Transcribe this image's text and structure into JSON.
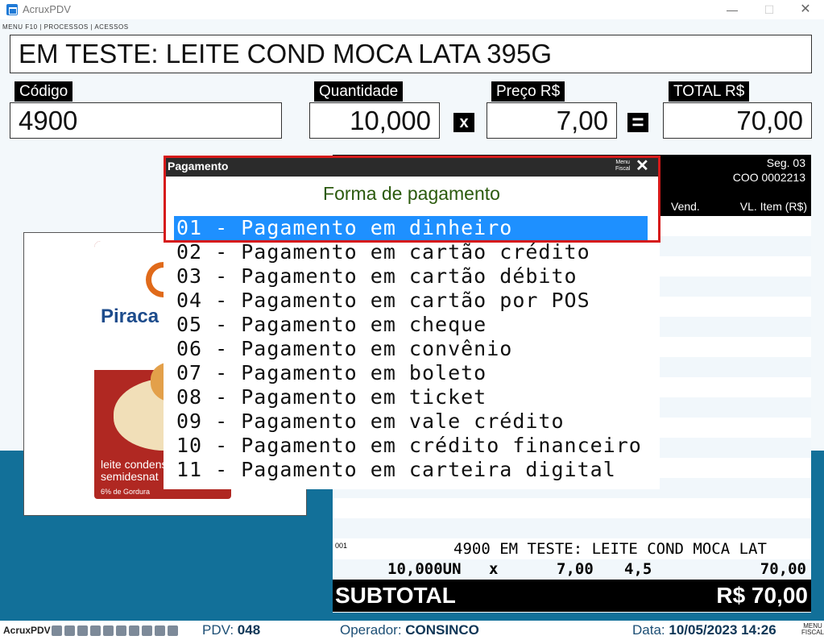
{
  "window": {
    "title": "AcruxPDV",
    "minimize": "—",
    "maximize": "☐",
    "close": "✕"
  },
  "menu_hint": "MENU F10 | PROCESSOS | ACESSOS",
  "product": {
    "title": "EM TESTE: LEITE COND MOCA LATA 395G"
  },
  "fields": {
    "codigo": {
      "label": "Código",
      "value": "4900"
    },
    "quantidade": {
      "label": "Quantidade",
      "value": "10,000"
    },
    "times": "x",
    "preco": {
      "label": "Preço R$",
      "value": "7,00"
    },
    "equals": "=",
    "total": {
      "label": "TOTAL R$",
      "value": "70,00"
    }
  },
  "product_image": {
    "brand": "Piraca",
    "text": "leite condensado semidesnat",
    "subtext": "6% de Gordura"
  },
  "receipt": {
    "seg": "Seg. 03",
    "coo": "COO 0002213",
    "col_vend": "Vend.",
    "col_vl": "VL. Item (R$)",
    "item": {
      "seq": "001",
      "desc": "4900 EM TESTE: LEITE COND MOCA LAT",
      "qty": "10,000UN",
      "x": "x",
      "price": "7,00",
      "aliq": "4,5",
      "total": "70,00"
    },
    "subtotal_label": "SUBTOTAL",
    "subtotal_value": "R$ 70,00"
  },
  "dialog": {
    "title": "Pagamento",
    "menu_top": "Menu",
    "menu_bottom": "Fiscal",
    "close": "✕",
    "subtitle": "Forma de pagamento",
    "options": [
      "01 - Pagamento em dinheiro",
      "02 - Pagamento em cartão crédito",
      "03 - Pagamento em cartão débito",
      "04 - Pagamento em cartão por POS",
      "05 - Pagamento em cheque",
      "06 - Pagamento em convênio",
      "07 - Pagamento em boleto",
      "08 - Pagamento em ticket",
      "09 - Pagamento em vale crédito",
      "10 - Pagamento em crédito financeiro",
      "11 - Pagamento em carteira digital"
    ]
  },
  "status": {
    "app": "AcruxPDV",
    "pdv_label": "PDV:",
    "pdv_value": "048",
    "op_label": "Operador:",
    "op_value": "CONSINCO",
    "data_label": "Data:",
    "data_value": "10/05/2023 14:26",
    "menu_top": "MENU",
    "menu_bottom": "FISCAL"
  }
}
